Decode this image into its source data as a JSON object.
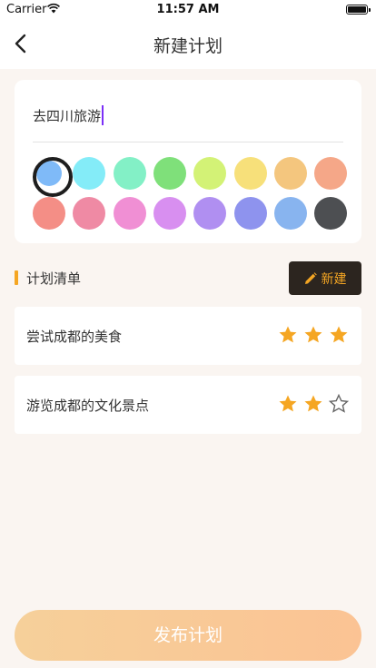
{
  "status_bar": {
    "carrier": "Carrier",
    "time": "11:57 AM"
  },
  "nav": {
    "title": "新建计划",
    "back_icon": "chevron-left-icon"
  },
  "plan_editor": {
    "name_value": "去四川旅游",
    "colors": [
      "#7fbaf8",
      "#84ecf8",
      "#83f0c6",
      "#7fe07a",
      "#d3f276",
      "#f7e07a",
      "#f4c67e",
      "#f5a788",
      "#f48e86",
      "#ef8aa4",
      "#f08fd4",
      "#d88ff0",
      "#b08ff1",
      "#8e93ee",
      "#88b4ef",
      "#4d4f52"
    ],
    "selected_color_index": 0
  },
  "list": {
    "section_title": "计划清单",
    "new_button_label": "新建",
    "items": [
      {
        "text": "尝试成都的美食",
        "rating": 3
      },
      {
        "text": "游览成都的文化景点",
        "rating": 2
      }
    ],
    "max_rating": 3,
    "star_color": "#f5a623"
  },
  "publish_button_label": "发布计划"
}
